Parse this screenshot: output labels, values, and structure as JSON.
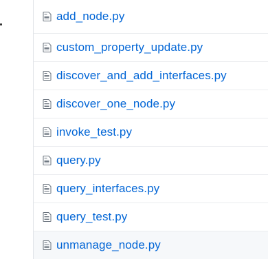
{
  "files": [
    {
      "name": "add_node.py",
      "icon": "file-text-icon"
    },
    {
      "name": "custom_property_update.py",
      "icon": "file-text-icon"
    },
    {
      "name": "discover_and_add_interfaces.py",
      "icon": "file-text-icon"
    },
    {
      "name": "discover_one_node.py",
      "icon": "file-text-icon"
    },
    {
      "name": "invoke_test.py",
      "icon": "file-text-icon"
    },
    {
      "name": "query.py",
      "icon": "file-text-icon"
    },
    {
      "name": "query_interfaces.py",
      "icon": "file-text-icon"
    },
    {
      "name": "query_test.py",
      "icon": "file-text-icon"
    },
    {
      "name": "unmanage_node.py",
      "icon": "file-text-icon"
    }
  ],
  "colors": {
    "link": "#0366d6",
    "icon": "#6a737d",
    "hover_row": "#f6f8fa",
    "border": "#eaecef"
  }
}
